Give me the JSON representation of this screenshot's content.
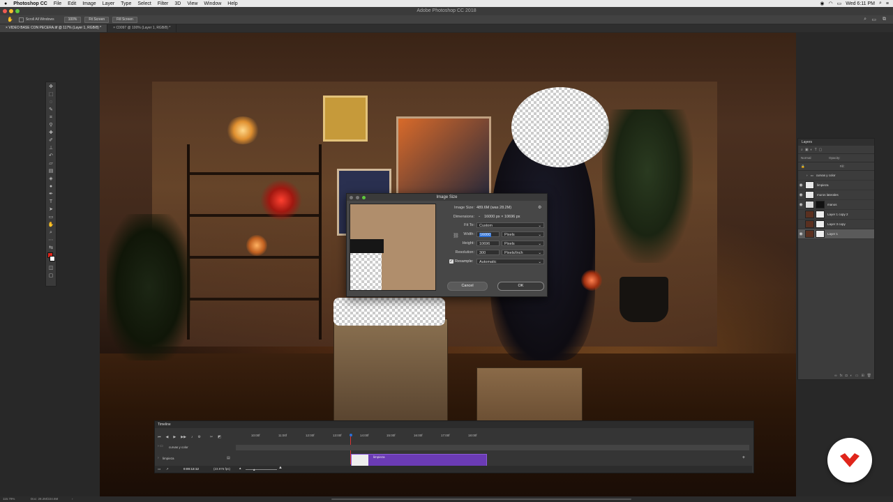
{
  "menubar": {
    "app_name": "Photoshop CC",
    "items": [
      "File",
      "Edit",
      "Image",
      "Layer",
      "Type",
      "Select",
      "Filter",
      "3D",
      "View",
      "Window",
      "Help"
    ],
    "clock": "Wed 6:11 PM"
  },
  "window": {
    "title": "Adobe Photoshop CC 2018"
  },
  "options_bar": {
    "scroll_all_label": "Scroll All Windows",
    "zoom_100": "100%",
    "fit_screen": "Fit Screen",
    "fill_screen": "Fill Screen"
  },
  "doc_tabs": [
    {
      "label": "VIDEO BASE CON PECERA.tif @ 117% (Layer 1, RGB/8) *"
    },
    {
      "label": "C0097 @ 100% (Layer 1, RGB/8) *"
    }
  ],
  "layers_panel": {
    "title": "Layers",
    "kind_label": "Normal",
    "opacity_label": "Opacity:",
    "fill_label": "Fill:",
    "layers": [
      {
        "name": "curvas y color",
        "type": "group",
        "visible": false
      },
      {
        "name": "limpieza",
        "visible": true
      },
      {
        "name": "muros laterales",
        "visible": true
      },
      {
        "name": "manos",
        "visible": true
      },
      {
        "name": "Layer 1 copy 2",
        "visible": false
      },
      {
        "name": "Layer 3 copy",
        "visible": false
      },
      {
        "name": "Layer 1",
        "visible": true,
        "selected": true
      }
    ]
  },
  "timeline": {
    "title": "Timeline",
    "ticks": [
      "10:00f",
      "11:00f",
      "12:00f",
      "13:00f",
      "14:00f",
      "15:00f",
      "16:00f",
      "17:00f",
      "18:00f"
    ],
    "tracks": [
      {
        "name": "curvas y color"
      },
      {
        "name": "limpieza"
      }
    ],
    "clip_label": "limpieza",
    "timecode": "0:00:13:12",
    "fps": "(23.976 fps)"
  },
  "dialog": {
    "title": "Image Size",
    "image_size_label": "Image Size:",
    "image_size_value": "489.6M (was 28.2M)",
    "dimensions_label": "Dimensions:",
    "dimensions_value": "16000 px  ×  10696 px",
    "fit_to_label": "Fit To:",
    "fit_to_value": "Custom",
    "width_label": "Width:",
    "width_value": "16000",
    "width_unit": "Pixels",
    "height_label": "Height:",
    "height_value": "10696",
    "height_unit": "Pixels",
    "resolution_label": "Resolution:",
    "resolution_value": "300",
    "resolution_unit": "Pixels/Inch",
    "resample_label": "Resample:",
    "resample_value": "Automatic",
    "cancel_label": "Cancel",
    "ok_label": "OK"
  },
  "status_bar": {
    "zoom": "116.79%",
    "doc": "Doc: 28.2M/224.6M"
  },
  "colors": {
    "accent": "#2b6fd6",
    "clip_purple": "#6b3bb5",
    "brand_red": "#e0251b"
  }
}
